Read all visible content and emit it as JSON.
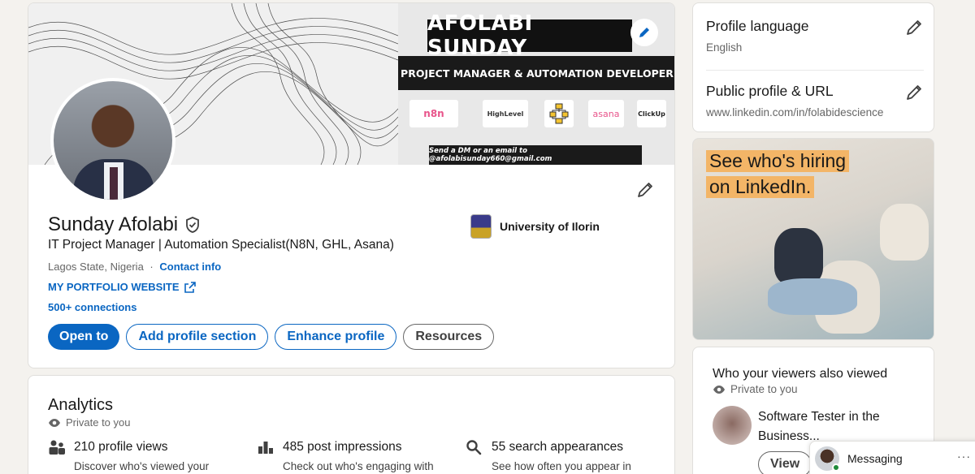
{
  "banner": {
    "name": "AFOLABI SUNDAY",
    "title": "PROJECT MANAGER & AUTOMATION DEVELOPER",
    "tools": [
      "n8n",
      "HighLevel",
      "asana",
      "ClickUp"
    ],
    "contact": "Send a DM or an email to @afolabisunday660@gmail.com"
  },
  "profile": {
    "name": "Sunday Afolabi",
    "headline": "IT Project Manager | Automation Specialist(N8N, GHL, Asana)",
    "location": "Lagos State, Nigeria",
    "separator": "·",
    "contact_link": "Contact info",
    "portfolio_link": "MY PORTFOLIO WEBSITE",
    "connections": "500+ connections",
    "university": "University of Ilorin",
    "actions": {
      "open_to": "Open to",
      "add_section": "Add profile section",
      "enhance": "Enhance profile",
      "resources": "Resources"
    }
  },
  "analytics": {
    "title": "Analytics",
    "private": "Private to you",
    "metrics": [
      {
        "value": "210 profile views",
        "sub": "Discover who's viewed your",
        "icon": "people-icon"
      },
      {
        "value": "485 post impressions",
        "sub": "Check out who's engaging with",
        "icon": "bar-chart-icon"
      },
      {
        "value": "55 search appearances",
        "sub": "See how often you appear in",
        "icon": "search-icon"
      }
    ]
  },
  "settings": {
    "language_title": "Profile language",
    "language_value": "English",
    "url_title": "Public profile & URL",
    "url_value": "www.linkedin.com/in/folabidescience"
  },
  "ad": {
    "line1": "See who's hiring",
    "line2": "on LinkedIn."
  },
  "viewers": {
    "title": "Who your viewers also viewed",
    "private": "Private to you",
    "headline": "Software Tester in the Business...",
    "view_button": "View"
  },
  "messaging": {
    "label": "Messaging",
    "more": "···"
  },
  "colors": {
    "brand_blue": "#0a66c2",
    "background": "#f4f2ee",
    "ad_highlight": "#f3b567"
  }
}
